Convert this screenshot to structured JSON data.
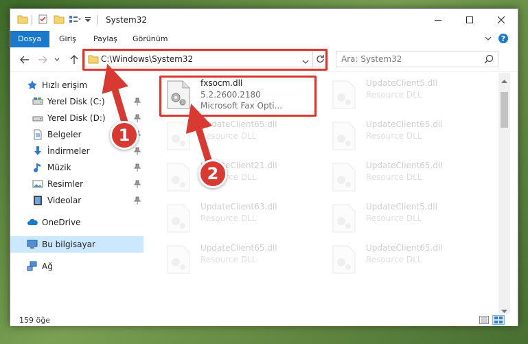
{
  "window": {
    "title": "System32",
    "controls": {
      "minimize_icon": "minimize-icon",
      "maximize_icon": "maximize-icon",
      "close_icon": "close-icon"
    }
  },
  "ribbon": {
    "tabs": [
      {
        "label": "Dosya",
        "active": true
      },
      {
        "label": "Giriş",
        "active": false
      },
      {
        "label": "Paylaş",
        "active": false
      },
      {
        "label": "Görünüm",
        "active": false
      }
    ]
  },
  "address": {
    "path": "C:\\Windows\\System32",
    "search_placeholder": "Ara: System32"
  },
  "sidebar": {
    "items": [
      {
        "label": "Hızlı erişim",
        "icon": "star-icon",
        "pinned": false
      },
      {
        "label": "Yerel Disk (C:)",
        "icon": "drive-icon",
        "pinned": true
      },
      {
        "label": "Yerel Disk (D:)",
        "icon": "drive-icon",
        "pinned": true
      },
      {
        "label": "Belgeler",
        "icon": "documents-icon",
        "pinned": true
      },
      {
        "label": "İndirmeler",
        "icon": "download-icon",
        "pinned": true
      },
      {
        "label": "Müzik",
        "icon": "music-icon",
        "pinned": true
      },
      {
        "label": "Resimler",
        "icon": "pictures-icon",
        "pinned": true
      },
      {
        "label": "Videolar",
        "icon": "videos-icon",
        "pinned": true
      },
      {
        "label": "OneDrive",
        "icon": "cloud-icon",
        "pinned": false
      },
      {
        "label": "Bu bilgisayar",
        "icon": "computer-icon",
        "pinned": false,
        "selected": true
      },
      {
        "label": "Ağ",
        "icon": "network-icon",
        "pinned": false
      }
    ]
  },
  "files": [
    {
      "name": "fxsocm.dll",
      "line2": "5.2.2600.2180",
      "line3": "Microsoft  Fax Opti...",
      "highlighted": true
    },
    {
      "name": "UpdateClient5.dll",
      "line2": "Resource DLL",
      "line3": ""
    },
    {
      "name": "UpdateClient65.dll",
      "line2": "Resource DLL",
      "line3": ""
    },
    {
      "name": "UpdateClient65.dll",
      "line2": "Resource DLL",
      "line3": ""
    },
    {
      "name": "UpdateClient21.dll",
      "line2": "Resource DLL",
      "line3": ""
    },
    {
      "name": "UpdateClient65.dll",
      "line2": "Resource DLL",
      "line3": ""
    },
    {
      "name": "UpdateClient63.dll",
      "line2": "Resource DLL",
      "line3": ""
    },
    {
      "name": "UpdateClient5.dll",
      "line2": "Resource DLL",
      "line3": ""
    },
    {
      "name": "UpdateClient65.dll",
      "line2": "Resource DLL",
      "line3": ""
    },
    {
      "name": "UpdateClient65.dll",
      "line2": "Resource DLL",
      "line3": ""
    }
  ],
  "status": {
    "item_count": "159 öğe"
  },
  "callouts": [
    {
      "number": "1",
      "target": "address-bar"
    },
    {
      "number": "2",
      "target": "file-tile"
    }
  ],
  "colors": {
    "accent": "#1979ca",
    "highlight": "#d9372f",
    "selected_bg": "#cce8ff"
  }
}
